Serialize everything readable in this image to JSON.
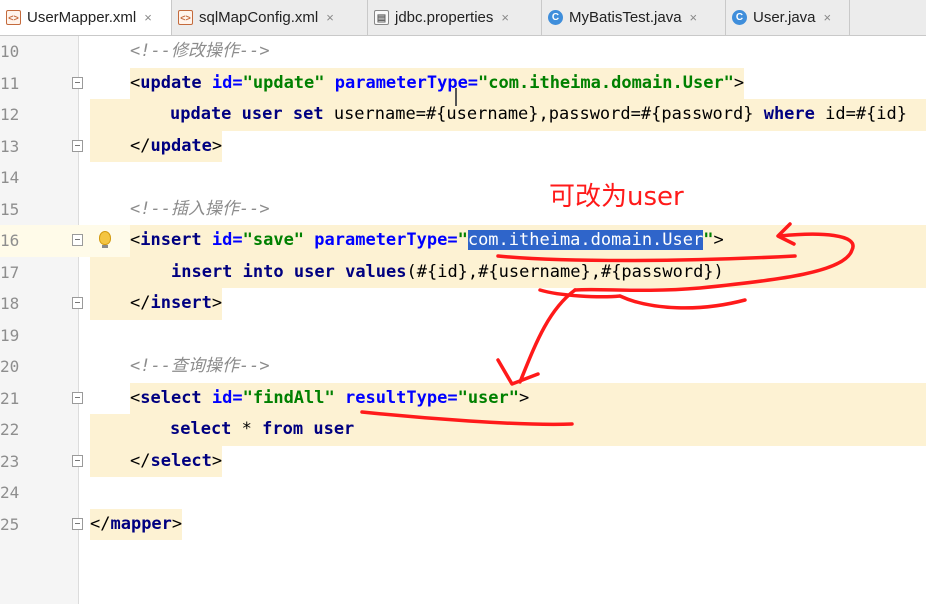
{
  "tabs": [
    {
      "label": "UserMapper.xml",
      "icon": "xml-file-icon",
      "active": true
    },
    {
      "label": "sqlMapConfig.xml",
      "icon": "xml-file-icon",
      "active": false
    },
    {
      "label": "jdbc.properties",
      "icon": "properties-file-icon",
      "active": false
    },
    {
      "label": "MyBatisTest.java",
      "icon": "java-class-icon",
      "active": false
    },
    {
      "label": "User.java",
      "icon": "java-class-icon",
      "active": false
    }
  ],
  "tab_close_glyph": "×",
  "line_numbers": [
    "10",
    "11",
    "12",
    "13",
    "14",
    "15",
    "16",
    "17",
    "18",
    "19",
    "20",
    "21",
    "22",
    "23",
    "24",
    "25"
  ],
  "code": {
    "l10": {
      "comment": "<!--修改操作-->"
    },
    "l11": {
      "lt": "<",
      "tag": "update",
      "a1": " id=",
      "v1": "\"update\"",
      "a2": " parameterType=",
      "v2": "\"com.itheima.domain.User\"",
      "gt": ">"
    },
    "l12": {
      "kw1": "update",
      "t1": " ",
      "kw2": "user",
      "t2": " ",
      "kw3": "set",
      "t3": " username=#{username},password=#{password} ",
      "kw4": "where",
      "t4": " id=#{id}"
    },
    "l13": {
      "lt": "</",
      "tag": "update",
      "gt": ">"
    },
    "l15": {
      "comment": "<!--插入操作-->"
    },
    "l16": {
      "lt": "<",
      "tag": "insert",
      "a1": " id=",
      "v1": "\"save\"",
      "a2": " parameterType=",
      "q1": "\"",
      "selected": "com.itheima.domain.User",
      "q2": "\"",
      "gt": ">"
    },
    "l17": {
      "kw1": "insert",
      "t1": " ",
      "kw2": "into",
      "t2": " ",
      "kw3": "user",
      "t3": " ",
      "kw4": "values",
      "t4": "(#{id},#{username},#{password})"
    },
    "l18": {
      "lt": "</",
      "tag": "insert",
      "gt": ">"
    },
    "l20": {
      "comment": "<!--查询操作-->"
    },
    "l21": {
      "lt": "<",
      "tag": "select",
      "a1": " id=",
      "v1": "\"findAll\"",
      "a2": " resultType=",
      "v2": "\"user\"",
      "gt": ">"
    },
    "l22": {
      "kw1": "select",
      "t1": " * ",
      "kw2": "from",
      "t2": " ",
      "kw3": "user"
    },
    "l23": {
      "lt": "</",
      "tag": "select",
      "gt": ">"
    },
    "l25": {
      "lt": "</",
      "tag": "mapper",
      "gt": ">"
    }
  },
  "annotation": {
    "text": "可改为user",
    "color": "#ff1a1a"
  },
  "colors": {
    "selection": "#2f65ca",
    "block_highlight": "#fdf2d3",
    "tag": "#000080",
    "attr": "#0000ff",
    "string": "#008000"
  }
}
